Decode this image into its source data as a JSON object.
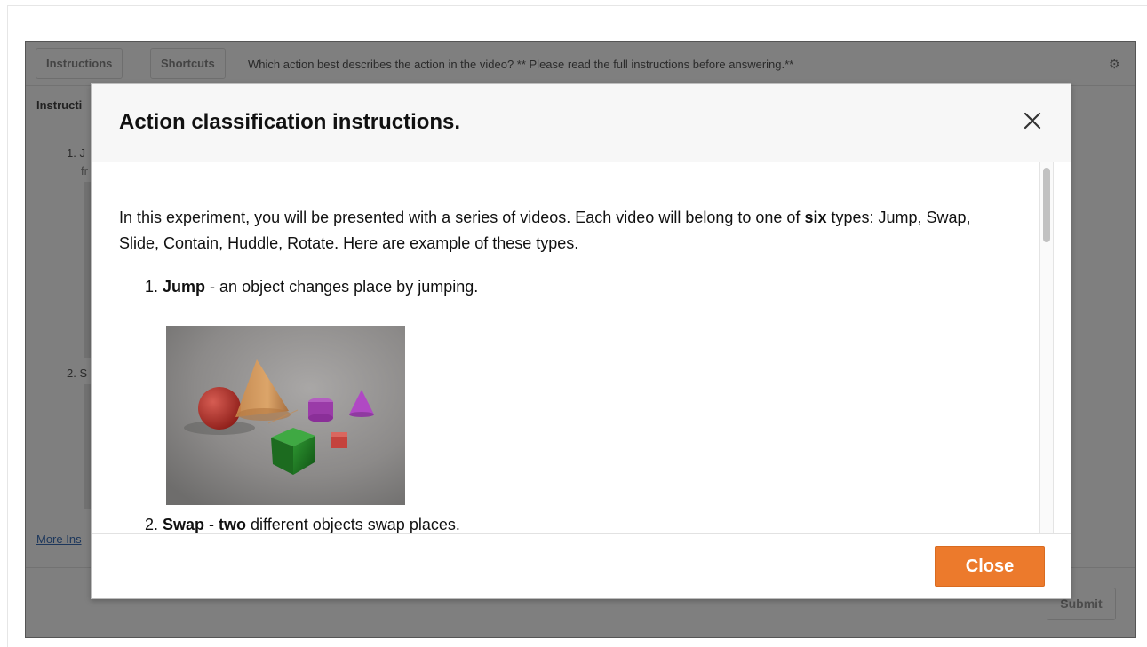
{
  "toolbar": {
    "instructions_label": "Instructions",
    "shortcuts_label": "Shortcuts",
    "question": "Which action best describes the action in the video? ** Please read the full instructions before answering.**",
    "settings_icon": "gear-icon"
  },
  "background": {
    "instructions_heading": "Instructi",
    "item1_number": "1. J",
    "item1_fragment": "fr",
    "item2_number": "2. S",
    "more_link": "More Ins",
    "submit_label": "Submit"
  },
  "modal": {
    "title": "Action classification instructions.",
    "close_icon": "close-x-icon",
    "intro_part1": "In this experiment, you will be presented with a series of videos. Each video will belong to one of ",
    "intro_bold": "six",
    "intro_part2": " types: Jump, Swap, Slide, Contain, Huddle, Rotate. Here are example of these types.",
    "items": [
      {
        "number": "1.",
        "name": "Jump",
        "description": " - an object changes place by jumping."
      },
      {
        "number": "2.",
        "name": "Swap",
        "description_pre": " - ",
        "emphasis": "two",
        "description_post": " different objects swap places."
      }
    ],
    "close_button_label": "Close",
    "accent_color": "#ec7a2c"
  }
}
